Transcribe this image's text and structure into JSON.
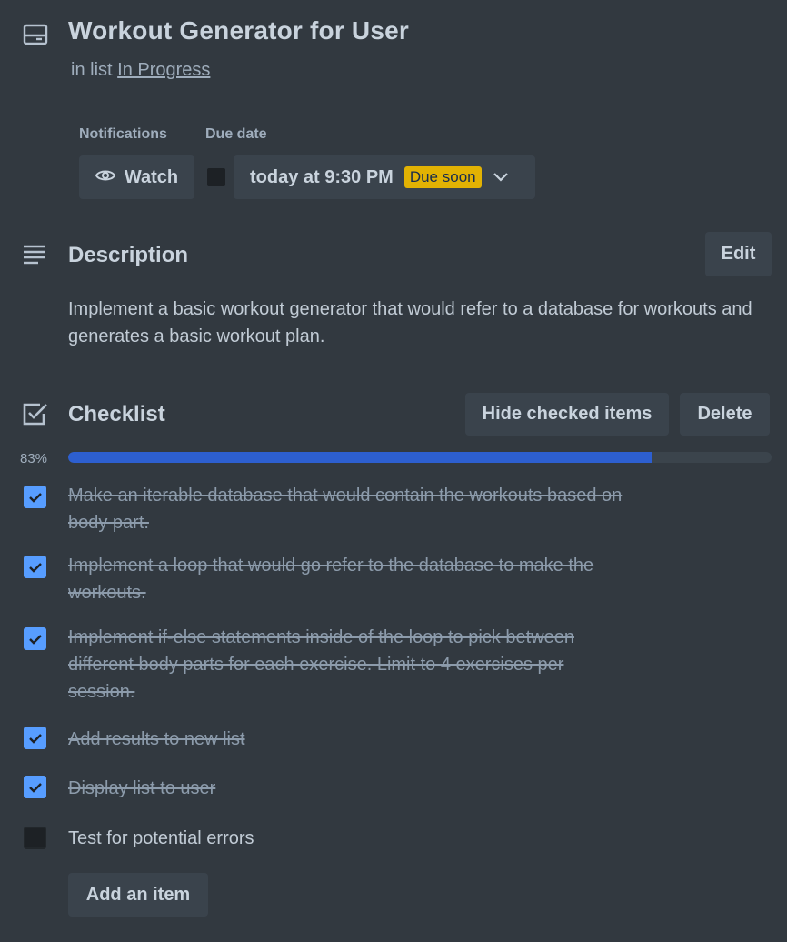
{
  "card": {
    "title": "Workout Generator for User",
    "in_list_prefix": "in list",
    "list_name": "In Progress"
  },
  "notifications": {
    "label": "Notifications",
    "watch_label": "Watch",
    "icon": "eye-icon"
  },
  "due_date": {
    "label": "Due date",
    "value": "today at 9:30 PM",
    "badge": "Due soon",
    "badge_color": "#e2b203",
    "checked": false
  },
  "description": {
    "title": "Description",
    "edit_label": "Edit",
    "text": "Implement a basic workout generator that would refer to a database for workouts and generates a basic workout plan."
  },
  "checklist": {
    "title": "Checklist",
    "hide_label": "Hide checked items",
    "delete_label": "Delete",
    "progress_label": "83%",
    "progress": 0.83,
    "progress_color": "#2d5fd0",
    "items": [
      {
        "text": "Make an iterable database that would contain the workouts based on body part.",
        "checked": true
      },
      {
        "text": "Implement a loop that would go refer to the database to make the workouts.",
        "checked": true
      },
      {
        "text": "Implement if-else statements inside of the loop to pick between different body parts for each exercise. Limit to 4 exercises per session.",
        "checked": true
      },
      {
        "text": "Add results to new list",
        "checked": true
      },
      {
        "text": "Display list to user",
        "checked": true
      },
      {
        "text": "Test for potential errors",
        "checked": false
      }
    ],
    "add_label": "Add an item"
  },
  "colors": {
    "background": "#323940",
    "button": "#3a434c",
    "checkbox_on": "#579dff"
  }
}
